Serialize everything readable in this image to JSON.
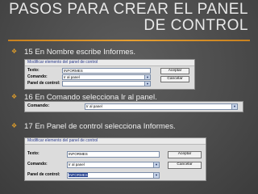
{
  "slide": {
    "title_line1": "PASOS PARA CREAR EL PANEL",
    "title_line2": "DE CONTROL",
    "bullets": [
      "15 En Nombre escribe Informes.",
      "16 En Comando selecciona Ir al panel.",
      "17 En Panel de control selecciona Informes."
    ]
  },
  "dialog1": {
    "title": "Modificar elemento del panel de control",
    "label_texto": "Texto:",
    "label_comando": "Comando:",
    "label_panel": "Panel de control:",
    "value_texto": "INFORMES",
    "value_comando": "Ir al panel",
    "value_panel": "",
    "accept": "Aceptar",
    "cancel": "Cancelar"
  },
  "dialog2": {
    "label_comando": "Comando:",
    "value_comando": "Ir al panel"
  },
  "dialog3": {
    "title": "Modificar elemento del panel de control",
    "label_texto": "Texto:",
    "label_comando": "Comando:",
    "label_panel": "Panel de control:",
    "value_texto": "INFORMES",
    "value_comando": "Ir al panel",
    "value_panel": "INFORMES",
    "accept": "Aceptar",
    "cancel": "Cancelar"
  }
}
